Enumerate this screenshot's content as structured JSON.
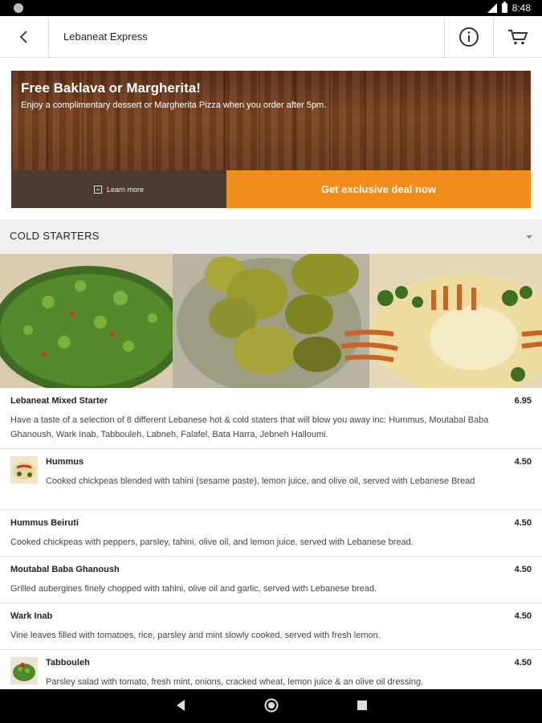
{
  "status_bar": {
    "time": "8:48"
  },
  "app_bar": {
    "title": "Lebaneat Express"
  },
  "promo": {
    "title": "Free Baklava or Margherita!",
    "subtitle": "Enjoy a complimentary dessert or Margherita Pizza when you order after 5pm.",
    "learn_more": "Learn more",
    "deal_button": "Get exclusive deal now"
  },
  "section": {
    "title": "COLD STARTERS"
  },
  "menu_items": [
    {
      "name": "Lebaneat Mixed Starter",
      "price": "6.95",
      "has_image": false,
      "description": "Have a taste of a selection of 8 different Lebanese hot & cold staters that will blow you away inc: Hummus, Moutabal Baba Ghanoush, Wark Inab, Tabbouleh, Labneh, Falafel, Bata Harra, Jebneh Halloumi."
    },
    {
      "name": "Hummus",
      "price": "4.50",
      "has_image": true,
      "description": "Cooked chickpeas blended with tahini (sesame paste), lemon juice, and olive oil, served with Lebanese Bread"
    },
    {
      "name": "Hummus Beiruti",
      "price": "4.50",
      "has_image": false,
      "description": "Cooked chickpeas with peppers, parsley, tahini, olive oil, and lemon juice, served with Lebanese bread."
    },
    {
      "name": "Moutabal Baba Ghanoush",
      "price": "4.50",
      "has_image": false,
      "description": "Grilled aubergines finely chopped with tahini, olive oil and garlic, served with Lebanese bread."
    },
    {
      "name": "Wark Inab",
      "price": "4.50",
      "has_image": false,
      "description": "Vine leaves filled with tomatoes, rice, parsley and mint slowly cooked, served with fresh lemon."
    },
    {
      "name": "Tabbouleh",
      "price": "4.50",
      "has_image": true,
      "description": "Parsley salad with tomato, fresh mint, onions, cracked wheat, lemon juice & an olive oil dressing."
    }
  ],
  "colors": {
    "accent": "#f28c1c",
    "learn_more_bg": "#4a3a30",
    "wood": "#6a381b"
  },
  "icons": {
    "back": "back-arrow-icon",
    "info": "info-icon",
    "cart": "cart-icon"
  }
}
